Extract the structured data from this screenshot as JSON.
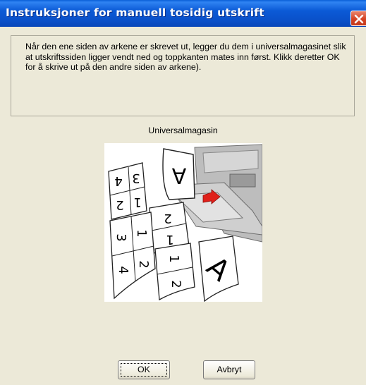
{
  "window": {
    "title": "Instruksjoner for manuell tosidig utskrift"
  },
  "message": "Når den ene siden av arkene er skrevet ut, legger du dem i universalmagasinet slik at utskriftssiden ligger vendt ned og toppkanten mates inn først. Klikk deretter OK for å skrive ut på den andre siden av arkene).",
  "illustration": {
    "caption": "Universalmagasin",
    "page_labels": [
      "A",
      "4",
      "3",
      "2",
      "1",
      "2",
      "1",
      "3",
      "4",
      "1",
      "2",
      "1",
      "2",
      "A"
    ]
  },
  "buttons": {
    "ok": "OK",
    "cancel": "Avbryt"
  },
  "colors": {
    "titlebar": "#0a5fd8",
    "dialog_bg": "#ece9d8",
    "close": "#d64323",
    "arrow": "#e0201a"
  }
}
